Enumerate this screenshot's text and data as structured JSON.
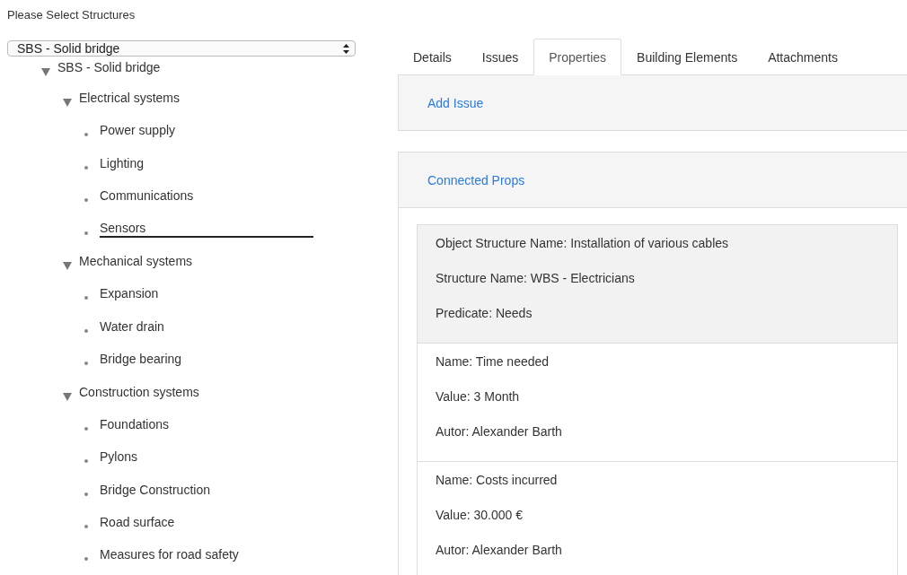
{
  "heading": "Please Select Structures",
  "structure_select": {
    "value": "SBS - Solid bridge"
  },
  "tree": [
    {
      "label": "SBS - Solid bridge",
      "expanded": true,
      "selected": false,
      "children": [
        {
          "label": "Electrical systems",
          "expanded": true,
          "selected": false,
          "children": [
            {
              "label": "Power supply",
              "selected": false
            },
            {
              "label": "Lighting",
              "selected": false
            },
            {
              "label": "Communications",
              "selected": false
            },
            {
              "label": "Sensors",
              "selected": true
            }
          ]
        },
        {
          "label": "Mechanical systems",
          "expanded": true,
          "selected": false,
          "children": [
            {
              "label": "Expansion",
              "selected": false
            },
            {
              "label": "Water drain",
              "selected": false
            },
            {
              "label": "Bridge bearing",
              "selected": false
            }
          ]
        },
        {
          "label": "Construction systems",
          "expanded": true,
          "selected": false,
          "children": [
            {
              "label": "Foundations",
              "selected": false
            },
            {
              "label": "Pylons",
              "selected": false
            },
            {
              "label": "Bridge Construction",
              "selected": false
            },
            {
              "label": "Road surface",
              "selected": false
            },
            {
              "label": "Measures for road safety",
              "selected": false
            }
          ]
        }
      ]
    }
  ],
  "tabs": [
    {
      "label": "Details",
      "selected": false
    },
    {
      "label": "Issues",
      "selected": false
    },
    {
      "label": "Properties",
      "selected": true
    },
    {
      "label": "Building Elements",
      "selected": false
    },
    {
      "label": "Attachments",
      "selected": false
    }
  ],
  "add_issue_link": "Add Issue",
  "connected_props_link": "Connected Props",
  "props": [
    {
      "kind": "relation",
      "lines": [
        "Object Structure Name: Installation of various cables",
        "Structure Name: WBS - Electricians",
        "Predicate: Needs"
      ]
    },
    {
      "kind": "property",
      "lines": [
        "Name: Time needed",
        "Value: 3 Month",
        "Autor: Alexander Barth"
      ]
    },
    {
      "kind": "property",
      "lines": [
        "Name: Costs incurred",
        "Value: 30.000 €",
        "Autor: Alexander Barth"
      ]
    }
  ]
}
